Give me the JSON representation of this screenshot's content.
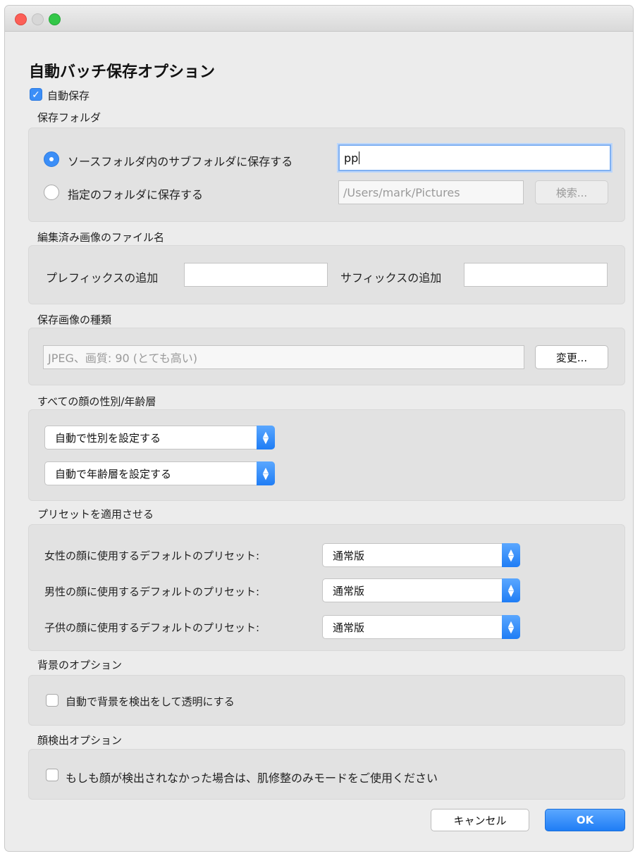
{
  "dialog": {
    "title": "自動バッチ保存オプション"
  },
  "autosave": {
    "label": "自動保存",
    "checked": true
  },
  "save_folder": {
    "heading": "保存フォルダ",
    "option_subfolder": "ソースフォルダ内のサブフォルダに保存する",
    "subfolder_value": "pp",
    "option_specified": "指定のフォルダに保存する",
    "specified_path": "/Users/mark/Pictures",
    "browse_label": "検索..."
  },
  "filename": {
    "heading": "編集済み画像のファイル名",
    "prefix_label": "プレフィックスの追加",
    "prefix_value": "",
    "suffix_label": "サフィックスの追加",
    "suffix_value": ""
  },
  "image_type": {
    "heading": "保存画像の種類",
    "value": "JPEG、画質: 90 (とても高い)",
    "change_label": "変更..."
  },
  "gender_age": {
    "heading": "すべての顔の性別/年齢層",
    "gender_select": "自動で性別を設定する",
    "age_select": "自動で年齢層を設定する"
  },
  "presets": {
    "heading": "プリセットを適用させる",
    "female_label": "女性の顔に使用するデフォルトのプリセット:",
    "female_value": "通常版",
    "male_label": "男性の顔に使用するデフォルトのプリセット:",
    "male_value": "通常版",
    "child_label": "子供の顔に使用するデフォルトのプリセット:",
    "child_value": "通常版"
  },
  "background": {
    "heading": "背景のオプション",
    "option": "自動で背景を検出をして透明にする",
    "checked": false
  },
  "face_detection": {
    "heading": "顔検出オプション",
    "option": "もしも顔が検出されなかった場合は、肌修整のみモードをご使用ください",
    "checked": false
  },
  "footer": {
    "cancel_label": "キャンセル",
    "ok_label": "OK"
  },
  "colors": {
    "accent": "#3b8ef7",
    "window_bg": "#ececec",
    "group_bg": "#e2e2e2"
  }
}
